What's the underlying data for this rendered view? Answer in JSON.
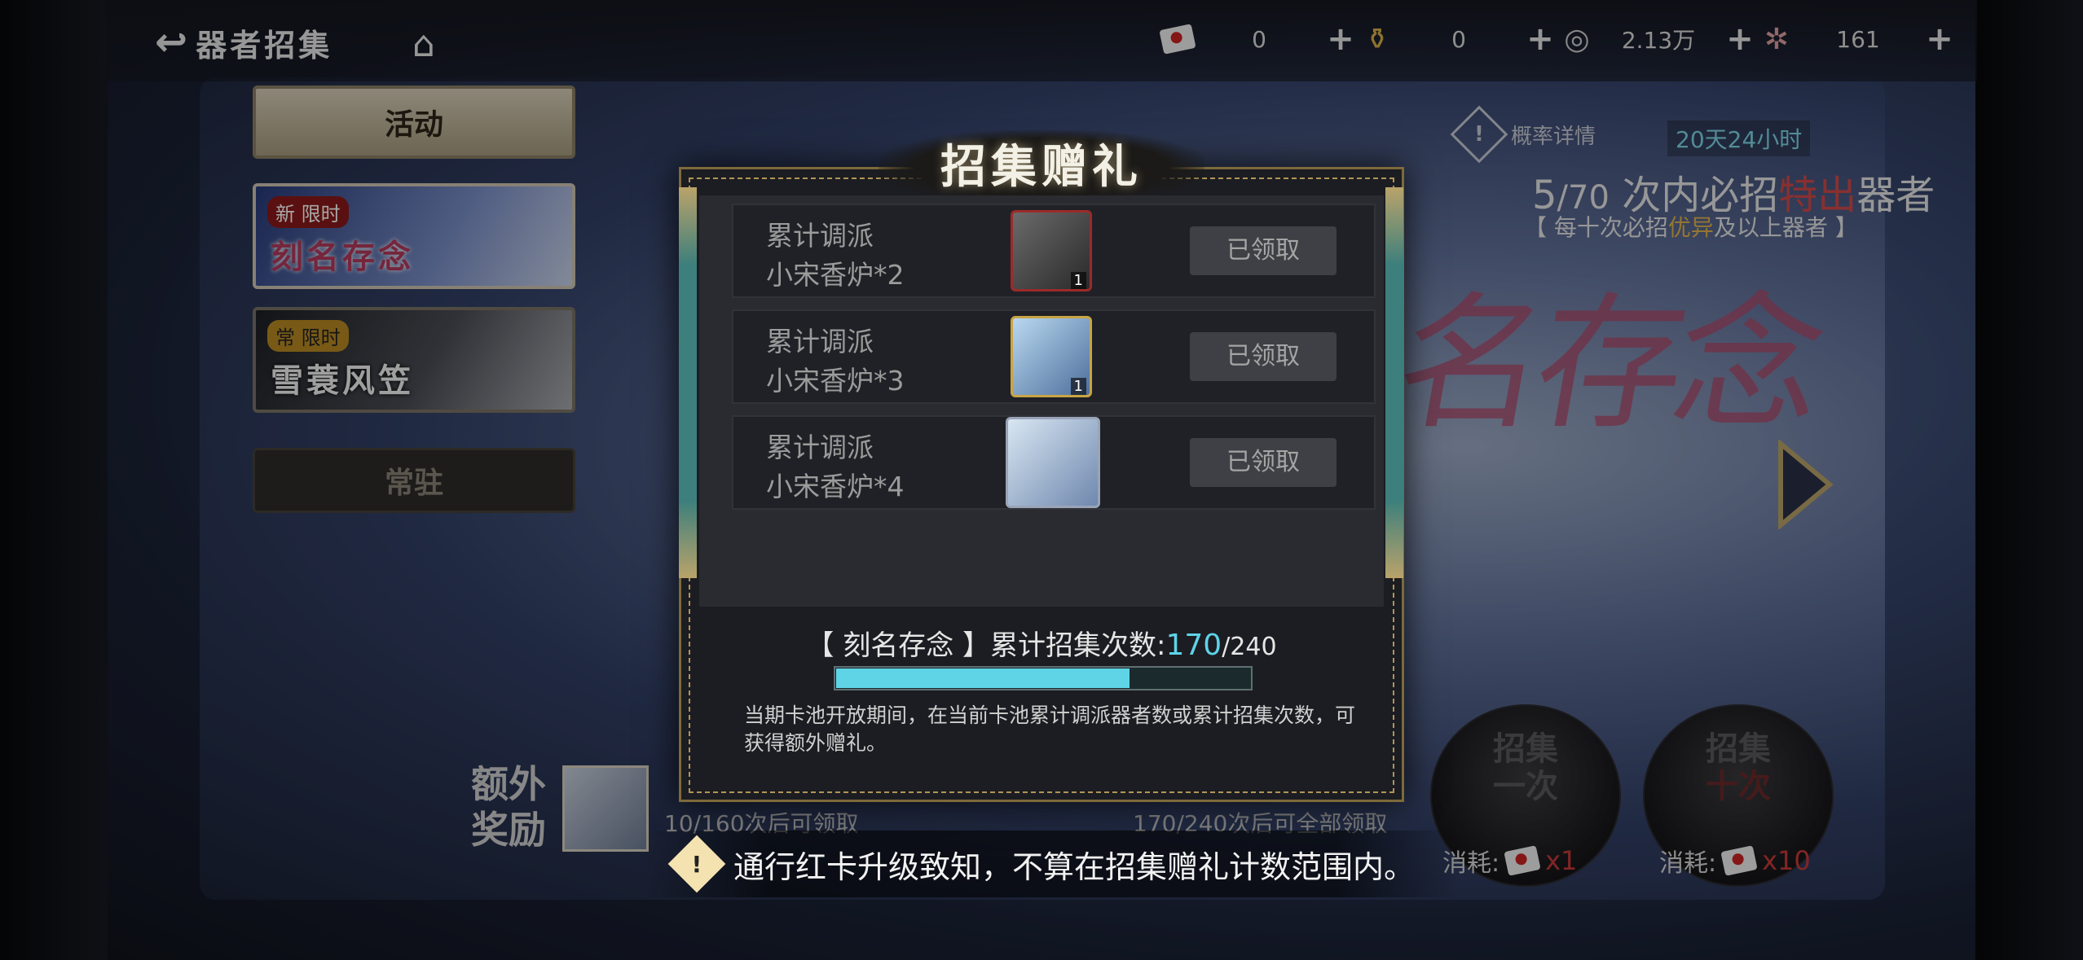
{
  "header": {
    "back_title": "器者招集",
    "resources": [
      {
        "icon": "red-envelope-icon",
        "value": "0"
      },
      {
        "icon": "gold-pot-icon",
        "value": "0"
      },
      {
        "icon": "silver-coin-icon",
        "value": "2.13万"
      },
      {
        "icon": "crystal-icon",
        "value": "161"
      }
    ]
  },
  "menu": {
    "activity": "活动",
    "banner1": {
      "tag_icon": "新",
      "tag": "限时",
      "name": "刻名存念"
    },
    "banner2": {
      "tag_icon": "常",
      "tag": "限时",
      "name": "雪蓑风笠"
    },
    "resident": "常驻"
  },
  "info": {
    "prob_label": "概率详情",
    "timer": "20天24小时",
    "pity_count": "5",
    "pity_total": "/70",
    "pity_text": "次内必招",
    "pity_red": "特出",
    "pity_end": "器者",
    "pity_sub_pre": "【 每十次必招",
    "pity_sub_gold": "优异",
    "pity_sub_post": "及以上器者 】",
    "calligraphy": "名存念"
  },
  "modal": {
    "title": "招集赠礼",
    "rewards": [
      {
        "line1": "累计调派",
        "line2": "小宋香炉*2",
        "qty": "1",
        "button": "已领取"
      },
      {
        "line1": "累计调派",
        "line2": "小宋香炉*3",
        "qty": "1",
        "button": "已领取"
      },
      {
        "line1": "累计调派",
        "line2": "小宋香炉*4",
        "qty": "",
        "button": "已领取"
      }
    ],
    "count_prefix": "【 刻名存念 】累计招集次数:",
    "count_current": "170",
    "count_total": "/240",
    "progress": 0.708,
    "description": "当期卡池开放期间，在当前卡池累计调派器者数或累计招集次数，可获得额外赠礼。"
  },
  "bottom": {
    "extra_label_1": "额外",
    "extra_label_2": "奖励",
    "extra_progress": "10/160次后可领取",
    "all_progress": "170/240次后可全部领取",
    "pull_one_1": "招集",
    "pull_one_2": "一次",
    "pull_ten_1": "招集",
    "pull_ten_2": "十次",
    "cost_label": "消耗:",
    "cost_one": "x1",
    "cost_ten": "x10"
  },
  "toast": {
    "text": "通行红卡升级致知，不算在招集赠礼计数范围内。"
  }
}
